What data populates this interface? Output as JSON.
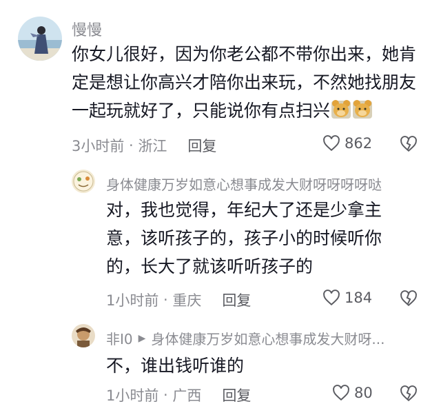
{
  "comments": [
    {
      "username": "慢慢",
      "text": "你女儿很好，因为你老公都不带你出来，她肯定是想让你高兴才陪你出来玩，不然她找朋友一起玩就好了，只能说你有点扫兴",
      "emoji": [
        "bear-emoji",
        "bear-emoji"
      ],
      "time": "3小时前",
      "location": "浙江",
      "reply_label": "回复",
      "likes": "862"
    },
    {
      "username": "身体健康万岁如意心想事成发大财呀呀呀呀哒",
      "text": "对，我也觉得，年纪大了还是少拿主意，该听孩子的，孩子小的时候听你的，长大了就该听听孩子的",
      "time": "1小时前",
      "location": "重庆",
      "reply_label": "回复",
      "likes": "184"
    },
    {
      "username": "非I0",
      "reply_to": "身体健康万岁如意心想事成发大财呀...",
      "text": "不，谁出钱听谁的",
      "time": "1小时前",
      "location": "广西",
      "reply_label": "回复",
      "likes": "80"
    }
  ],
  "icons": {
    "like": "heart-outline-icon",
    "dislike": "broken-heart-icon",
    "reply_arrow": "play-arrow-icon"
  }
}
